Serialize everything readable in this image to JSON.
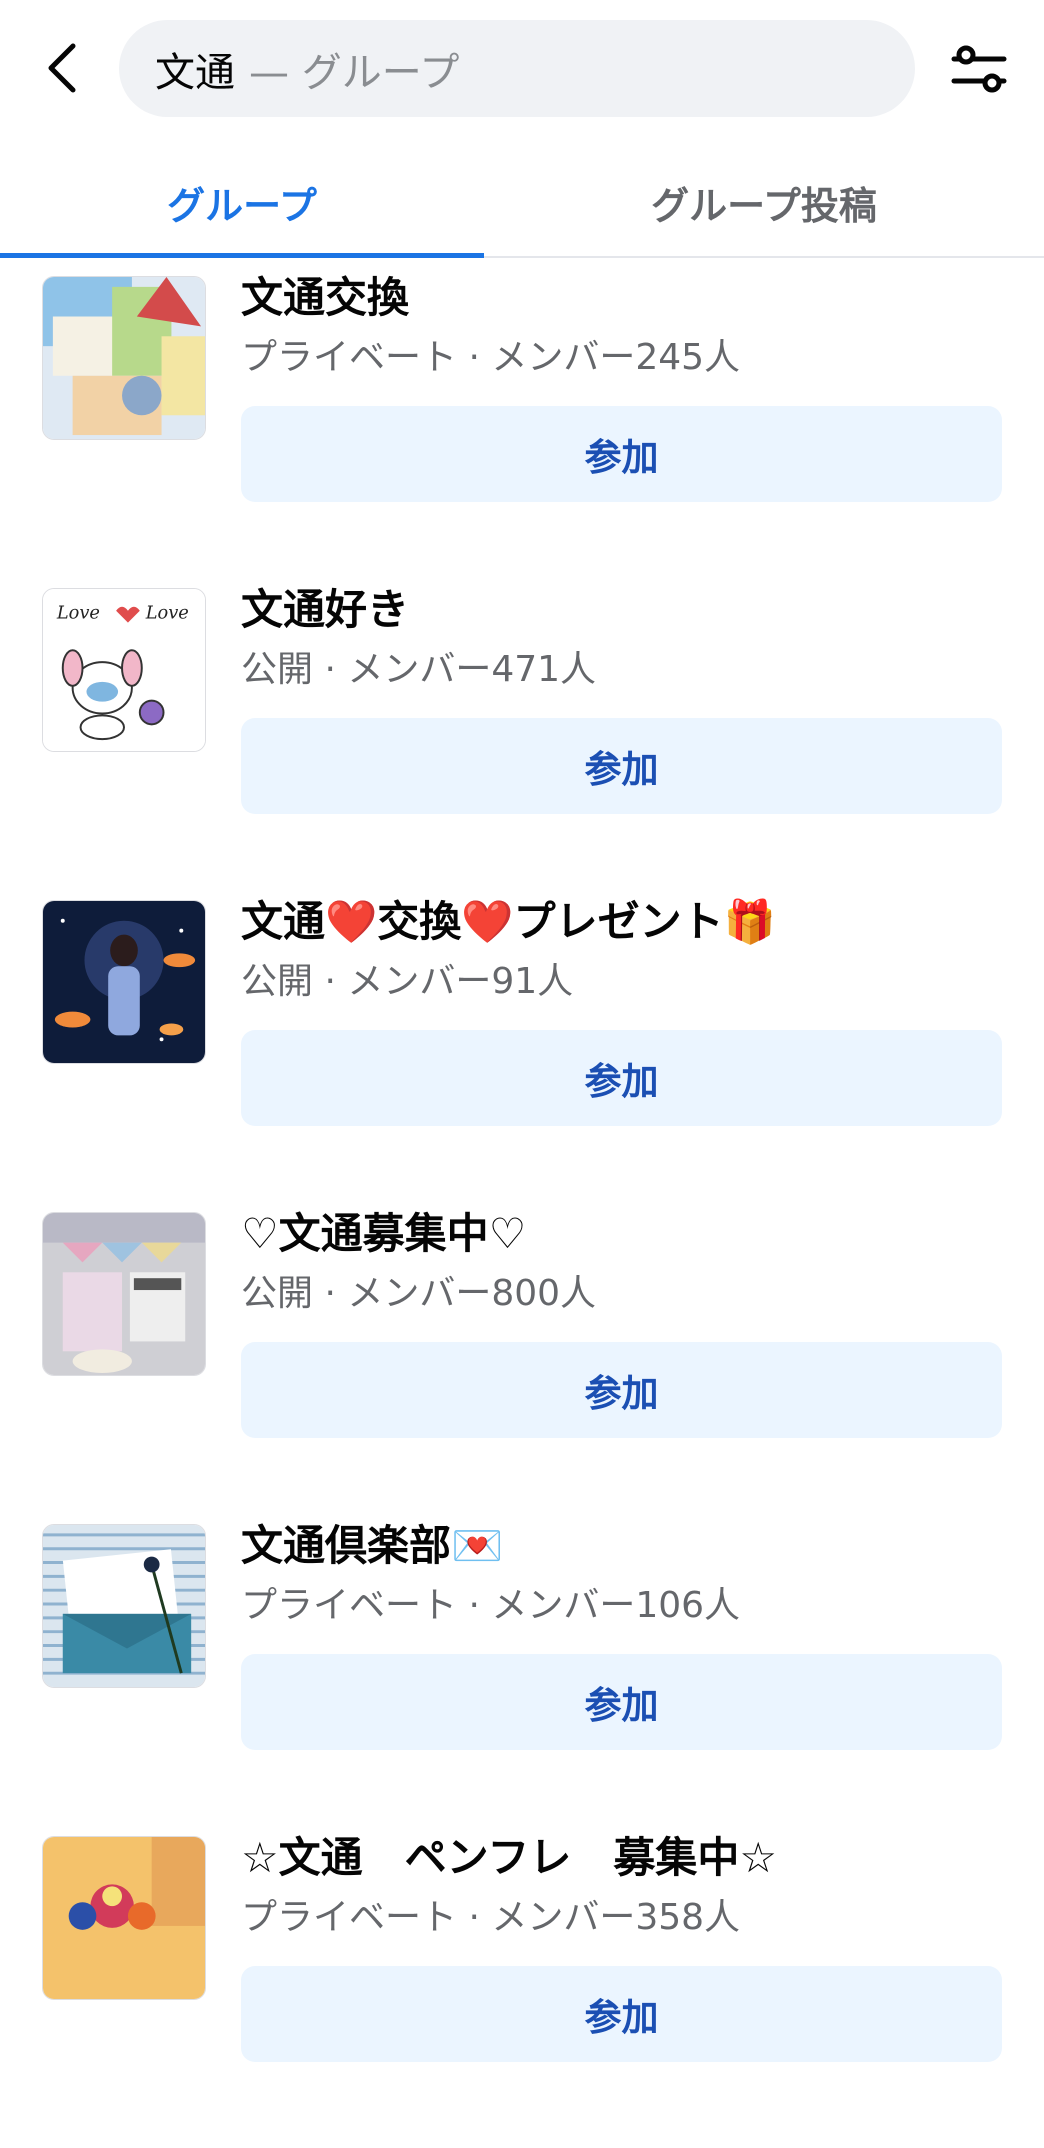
{
  "header": {
    "search": {
      "query": "文通",
      "suffix": "— グループ"
    }
  },
  "tabs": [
    {
      "label": "グループ",
      "active": true
    },
    {
      "label": "グループ投稿",
      "active": false
    }
  ],
  "groups": [
    {
      "name": "文通交換",
      "meta": "プライベート · メンバー245人",
      "join_label": "参加"
    },
    {
      "name": "文通好き",
      "meta": "公開 · メンバー471人",
      "join_label": "参加"
    },
    {
      "name": "文通❤️交換❤️プレゼント🎁",
      "meta": "公開 · メンバー91人",
      "join_label": "参加"
    },
    {
      "name": "♡文通募集中♡",
      "meta": "公開 · メンバー800人",
      "join_label": "参加"
    },
    {
      "name": "文通倶楽部💌",
      "meta": "プライベート · メンバー106人",
      "join_label": "参加"
    },
    {
      "name": "☆文通　ペンフレ　募集中☆",
      "meta": "プライベート · メンバー358人",
      "join_label": "参加"
    }
  ],
  "colors": {
    "accent": "#1b74e4",
    "join_bg": "#ebf5ff",
    "join_text": "#1b4fb3",
    "muted": "#65676b"
  },
  "icons": [
    "back-arrow-icon",
    "filter-sliders-icon"
  ]
}
